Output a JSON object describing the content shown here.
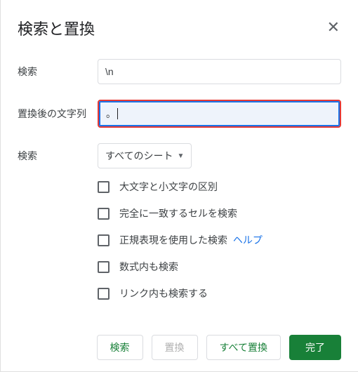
{
  "dialog": {
    "title": "検索と置換",
    "close_icon": "✕"
  },
  "fields": {
    "search_label": "検索",
    "search_value": "\\n",
    "replace_label": "置換後の文字列",
    "replace_value": "。",
    "scope_label": "検索",
    "scope_selected": "すべてのシート"
  },
  "options": {
    "match_case": "大文字と小文字の区別",
    "entire_cell": "完全に一致するセルを検索",
    "regex": "正規表現を使用した検索",
    "regex_help": "ヘルプ",
    "formulas": "数式内も検索",
    "links": "リンク内も検索する"
  },
  "buttons": {
    "find": "検索",
    "replace": "置換",
    "replace_all": "すべて置換",
    "done": "完了"
  }
}
